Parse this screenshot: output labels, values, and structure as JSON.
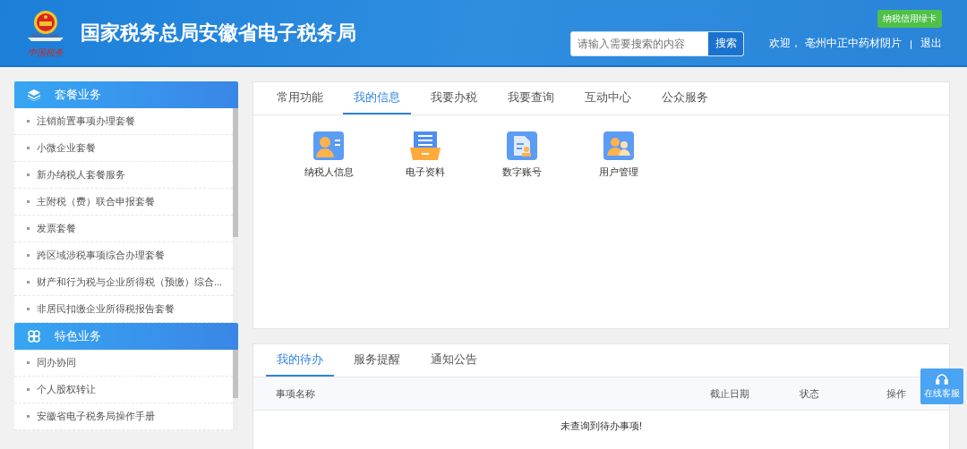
{
  "header": {
    "title": "国家税务总局安徽省电子税务局",
    "logo_caption": "中国税务",
    "search": {
      "placeholder": "请输入需要搜索的内容",
      "button": "搜索"
    },
    "badge": "纳税信用绿卡",
    "welcome": "欢迎，",
    "user": "亳州中正中药材阴片",
    "separator": "|",
    "logout": "退出"
  },
  "sidebar": {
    "sections": [
      {
        "title": "套餐业务",
        "kind": "layers",
        "items": [
          "注销前置事项办理套餐",
          "小微企业套餐",
          "新办纳税人套餐服务",
          "主附税（费）联合申报套餐",
          "发票套餐",
          "跨区域涉税事项综合办理套餐",
          "财产和行为税与企业所得税（预缴）综合...",
          "非居民扣缴企业所得税报告套餐"
        ]
      },
      {
        "title": "特色业务",
        "kind": "clover",
        "items": [
          "同办协同",
          "个人股权转让",
          "安徽省电子税务局操作手册"
        ]
      }
    ]
  },
  "main_tabs": [
    {
      "label": "常用功能",
      "selected": false
    },
    {
      "label": "我的信息",
      "selected": true
    },
    {
      "label": "我要办税",
      "selected": false
    },
    {
      "label": "我要查询",
      "selected": false
    },
    {
      "label": "互动中心",
      "selected": false
    },
    {
      "label": "公众服务",
      "selected": false
    }
  ],
  "functions": [
    {
      "label": "纳税人信息",
      "kind": "person-card"
    },
    {
      "label": "电子资料",
      "kind": "tray"
    },
    {
      "label": "数字账号",
      "kind": "stamp-doc"
    },
    {
      "label": "用户管理",
      "kind": "users"
    }
  ],
  "todo_tabs": [
    {
      "label": "我的待办",
      "selected": true
    },
    {
      "label": "服务提醒",
      "selected": false
    },
    {
      "label": "通知公告",
      "selected": false
    }
  ],
  "todo_table": {
    "columns": [
      "事项名称",
      "截止日期",
      "状态",
      "操作"
    ],
    "empty_message": "未查询到待办事项!"
  },
  "service_button": "在线客服"
}
